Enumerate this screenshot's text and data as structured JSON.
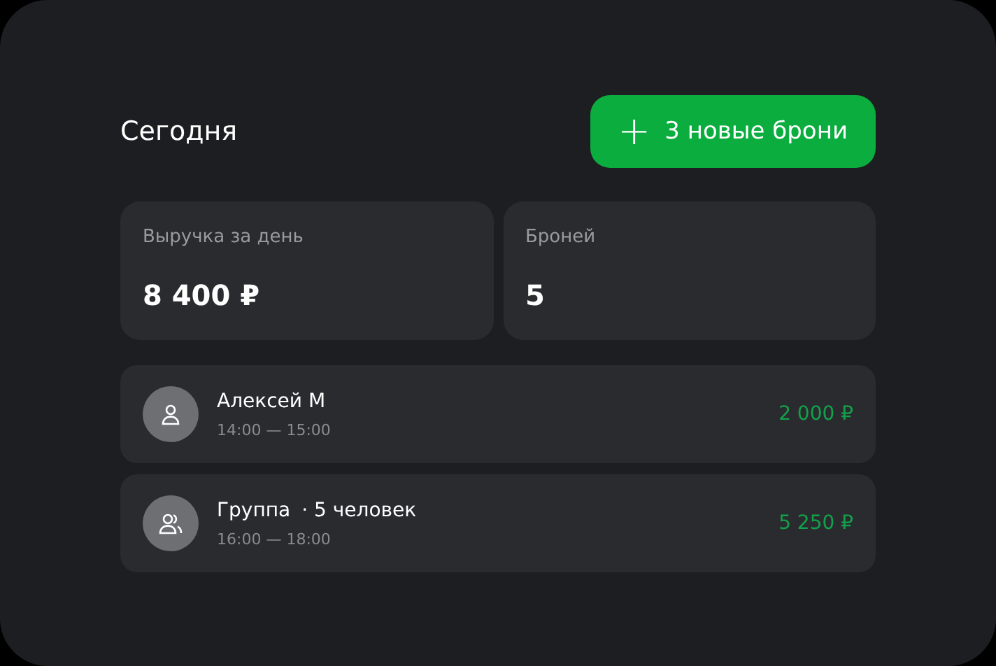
{
  "header": {
    "title": "Сегодня",
    "button": {
      "icon": "+",
      "label": "3 новые брони"
    }
  },
  "stats": [
    {
      "label": "Выручка за день",
      "value": "8 400 ₽"
    },
    {
      "label": "Броней",
      "value": "5"
    }
  ],
  "bookings": [
    {
      "kind": "person",
      "name": "Алексей М",
      "time": "14:00 — 15:00",
      "amount": "2 000 ₽"
    },
    {
      "kind": "group",
      "name": "Группа",
      "extra": "· 5 человек",
      "time": "16:00 — 18:00",
      "amount": "5 250 ₽"
    }
  ]
}
